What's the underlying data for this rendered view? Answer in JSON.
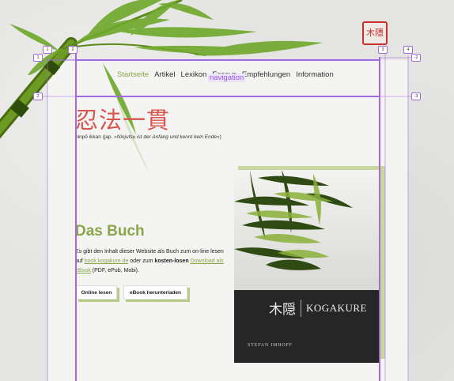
{
  "seal": {
    "text": "木隱"
  },
  "nav": {
    "items": [
      {
        "label": "Startseite",
        "active": true
      },
      {
        "label": "Artikel"
      },
      {
        "label": "Lexikon"
      },
      {
        "label": "Essays"
      },
      {
        "label": "Empfehlungen"
      },
      {
        "label": "Information"
      }
    ],
    "overlay_tag": "navigation"
  },
  "header": {
    "logo": "忍法一貫",
    "subtitle_prefix": "ninpō ikkan (jap. ",
    "subtitle_quote": "»Ninjutsu ist der Anfang und kennt kein Ende«",
    "subtitle_suffix": ")"
  },
  "book": {
    "heading": "Das Buch",
    "text_1": "Es gibt den Inhalt dieser Website als Buch zum on-line lesen auf ",
    "link_1": "book.kogakure.de",
    "text_2": " oder zum ",
    "bold_1": "kosten-losen",
    "text_3": " ",
    "link_2": "Download als eBook",
    "text_4": " (PDF, ePub, Mobi).",
    "btn_read": "Online lesen",
    "btn_download": "eBook herunterladen"
  },
  "cover": {
    "kanji": "木隠",
    "title": "KOGAKURE",
    "author": "STEFAN IMHOFF"
  },
  "guides": {
    "markers": [
      "1",
      "2",
      "3",
      "4",
      "-2",
      "-3"
    ]
  },
  "colors": {
    "accent_green": "#8aa64a",
    "logo_red": "#d9534f",
    "guide_purple": "#9b59e8"
  }
}
